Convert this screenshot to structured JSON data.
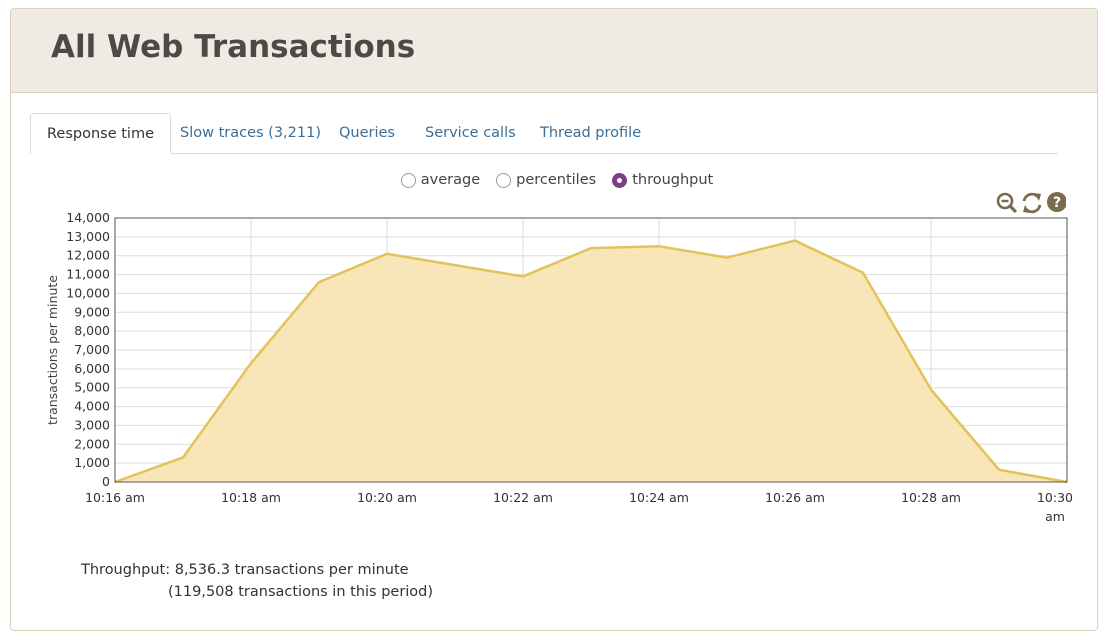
{
  "page": {
    "title": "All Web Transactions"
  },
  "tabs": [
    {
      "label": "Response time",
      "active": true
    },
    {
      "label": "Slow traces (3,211)",
      "active": false
    },
    {
      "label": "Queries",
      "active": false
    },
    {
      "label": "Service calls",
      "active": false
    },
    {
      "label": "Thread profile",
      "active": false
    }
  ],
  "view_options": [
    {
      "label": "average",
      "checked": false
    },
    {
      "label": "percentiles",
      "checked": false
    },
    {
      "label": "throughput",
      "checked": true
    }
  ],
  "tools": [
    {
      "icon": "zoom-out-icon"
    },
    {
      "icon": "refresh-icon"
    },
    {
      "icon": "help-icon"
    }
  ],
  "colors": {
    "accent": "#7b3f85",
    "area_fill": "#f8e3b0",
    "area_line": "#e3c25c",
    "link": "#3a6f97"
  },
  "summary": {
    "line1": "Throughput: 8,536.3 transactions per minute",
    "line2": "(119,508 transactions in this period)"
  },
  "chart_data": {
    "type": "area",
    "ylabel": "transactions per minute",
    "xlabel": "",
    "ylim": [
      0,
      14000
    ],
    "y_ticks": [
      "0",
      "1,000",
      "2,000",
      "3,000",
      "4,000",
      "5,000",
      "6,000",
      "7,000",
      "8,000",
      "9,000",
      "10,000",
      "11,000",
      "12,000",
      "13,000",
      "14,000"
    ],
    "x_ticks": [
      {
        "minute": 16,
        "label": "10:16 am"
      },
      {
        "minute": 18,
        "label": "10:18 am"
      },
      {
        "minute": 20,
        "label": "10:20 am"
      },
      {
        "minute": 22,
        "label": "10:22 am"
      },
      {
        "minute": 24,
        "label": "10:24 am"
      },
      {
        "minute": 26,
        "label": "10:26 am"
      },
      {
        "minute": 28,
        "label": "10:28 am"
      },
      {
        "minute": 30,
        "label": "10:30 am"
      }
    ],
    "grid": true,
    "series": [
      {
        "points": [
          {
            "minute": 16,
            "value": 0
          },
          {
            "minute": 17,
            "value": 1300
          },
          {
            "minute": 18,
            "value": 6300
          },
          {
            "minute": 19,
            "value": 10600
          },
          {
            "minute": 20,
            "value": 12100
          },
          {
            "minute": 21,
            "value": 11500
          },
          {
            "minute": 22,
            "value": 10900
          },
          {
            "minute": 23,
            "value": 12400
          },
          {
            "minute": 24,
            "value": 12500
          },
          {
            "minute": 25,
            "value": 11900
          },
          {
            "minute": 26,
            "value": 12800
          },
          {
            "minute": 27,
            "value": 11100
          },
          {
            "minute": 28,
            "value": 4900
          },
          {
            "minute": 29,
            "value": 650
          },
          {
            "minute": 30,
            "value": 0
          }
        ]
      }
    ]
  }
}
